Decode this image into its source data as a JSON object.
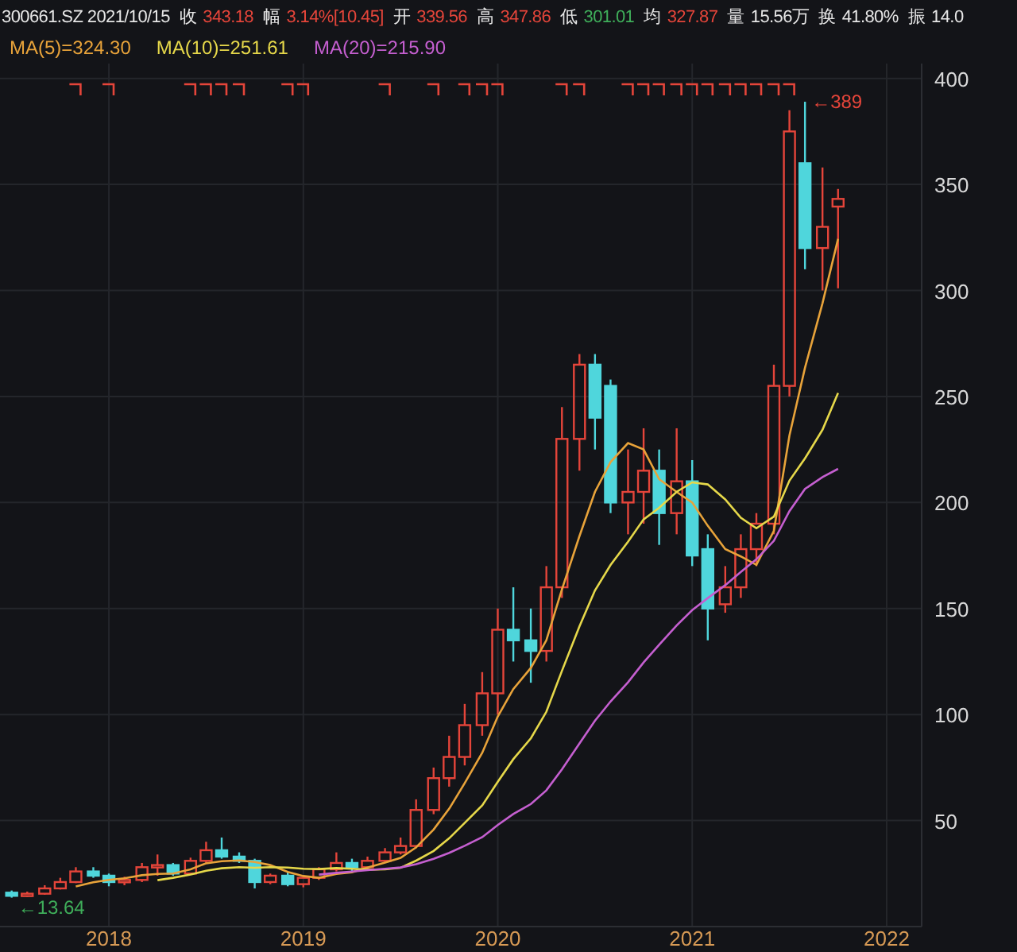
{
  "header": [
    {
      "value": "300661.SZ 2021/10/15",
      "color": "#e6e6e6"
    },
    {
      "label": "收",
      "value": "343.18",
      "color": "#e5453a"
    },
    {
      "label": "幅",
      "value": "3.14%[10.45]",
      "color": "#e5453a"
    },
    {
      "label": "开",
      "value": "339.56",
      "color": "#e5453a"
    },
    {
      "label": "高",
      "value": "347.86",
      "color": "#e5453a"
    },
    {
      "label": "低",
      "value": "301.01",
      "color": "#3fae5a"
    },
    {
      "label": "均",
      "value": "327.87",
      "color": "#e5453a"
    },
    {
      "label": "量",
      "value": "15.56万",
      "color": "#e6e6e6"
    },
    {
      "label": "换",
      "value": "41.80%",
      "color": "#e6e6e6"
    },
    {
      "label": "振",
      "value": "14.0",
      "color": "#e6e6e6"
    }
  ],
  "legend_values": [
    "=324.30",
    "=251.61",
    "=215.90"
  ],
  "chart_data": {
    "type": "candlestick",
    "grid": true,
    "ylim": [
      0,
      407
    ],
    "xlim": [
      2017.44,
      2022.18
    ],
    "xticks": [
      {
        "value": 2018,
        "label": "2018"
      },
      {
        "value": 2019,
        "label": "2019"
      },
      {
        "value": 2020,
        "label": "2020"
      },
      {
        "value": 2021,
        "label": "2021"
      },
      {
        "value": 2022,
        "label": "2022"
      }
    ],
    "yticks": [
      50,
      100,
      150,
      200,
      250,
      300,
      350,
      400
    ],
    "x": [
      2017.5,
      2017.58,
      2017.67,
      2017.75,
      2017.83,
      2017.92,
      2018,
      2018.08,
      2018.17,
      2018.25,
      2018.33,
      2018.42,
      2018.5,
      2018.58,
      2018.67,
      2018.75,
      2018.83,
      2018.92,
      2019,
      2019.08,
      2019.17,
      2019.25,
      2019.33,
      2019.42,
      2019.5,
      2019.58,
      2019.67,
      2019.75,
      2019.83,
      2019.92,
      2020,
      2020.08,
      2020.17,
      2020.25,
      2020.33,
      2020.42,
      2020.5,
      2020.58,
      2020.67,
      2020.75,
      2020.83,
      2020.92,
      2021,
      2021.08,
      2021.17,
      2021.25,
      2021.33,
      2021.42,
      2021.5,
      2021.58,
      2021.67,
      2021.75
    ],
    "ohlc": [
      [
        16,
        17,
        13.64,
        14.5
      ],
      [
        14.5,
        16.5,
        14,
        15.5
      ],
      [
        15.5,
        19.5,
        15,
        18
      ],
      [
        18,
        23,
        17.5,
        21
      ],
      [
        21,
        28,
        20.5,
        26
      ],
      [
        26,
        28,
        23,
        24
      ],
      [
        24,
        25,
        19,
        21
      ],
      [
        21,
        23.5,
        19.5,
        22
      ],
      [
        22,
        30,
        21,
        28
      ],
      [
        28,
        34,
        24,
        29
      ],
      [
        29,
        30,
        24,
        25
      ],
      [
        25,
        32.5,
        24.5,
        31
      ],
      [
        31,
        40,
        30,
        36
      ],
      [
        36,
        42,
        32,
        33
      ],
      [
        33,
        35,
        30,
        31
      ],
      [
        31,
        32,
        18,
        21
      ],
      [
        21,
        25,
        20,
        24
      ],
      [
        24,
        25.5,
        19,
        20
      ],
      [
        20,
        24,
        18.5,
        23
      ],
      [
        23,
        28,
        22,
        27
      ],
      [
        27,
        35,
        26,
        30
      ],
      [
        30,
        32,
        26,
        28
      ],
      [
        28,
        33,
        27,
        31
      ],
      [
        31,
        37,
        30,
        35
      ],
      [
        35,
        42,
        34,
        38
      ],
      [
        38,
        60,
        37,
        55
      ],
      [
        55,
        75,
        53,
        70
      ],
      [
        70,
        90,
        66,
        80
      ],
      [
        80,
        105,
        76,
        95
      ],
      [
        95,
        120,
        90,
        110
      ],
      [
        110,
        150,
        100,
        140
      ],
      [
        140,
        160,
        125,
        135
      ],
      [
        135,
        150,
        115,
        130
      ],
      [
        130,
        170,
        125,
        160
      ],
      [
        160,
        245,
        155,
        230
      ],
      [
        230,
        270,
        215,
        265
      ],
      [
        265,
        270,
        225,
        240
      ],
      [
        255,
        258,
        195,
        200
      ],
      [
        200,
        225,
        185,
        205
      ],
      [
        205,
        235,
        190,
        215
      ],
      [
        215,
        225,
        180,
        195
      ],
      [
        195,
        235,
        185,
        210
      ],
      [
        210,
        220,
        170,
        175
      ],
      [
        178,
        185,
        135,
        150
      ],
      [
        152,
        170,
        148,
        160
      ],
      [
        160,
        185,
        155,
        178
      ],
      [
        178,
        195,
        170,
        190
      ],
      [
        190,
        265,
        185,
        255
      ],
      [
        255,
        385,
        250,
        375
      ],
      [
        360,
        389,
        310,
        320
      ],
      [
        320,
        358,
        300,
        330
      ],
      [
        339.56,
        347.86,
        301.01,
        343.18
      ]
    ],
    "series": [
      {
        "name": "MA(5)",
        "type": "line",
        "color": "#e8a33a",
        "values": [
          null,
          null,
          null,
          null,
          19,
          20.9,
          22,
          22.8,
          24.2,
          24.8,
          25,
          27,
          29.8,
          30.8,
          31.2,
          30.4,
          29,
          25.8,
          23.8,
          23,
          24.8,
          25.6,
          27.8,
          30.2,
          32.4,
          37.4,
          45.8,
          55.6,
          67.6,
          82,
          99,
          112,
          122,
          135,
          159,
          184,
          205,
          219,
          228,
          225,
          211,
          205,
          200,
          189,
          178,
          174.6,
          170.6,
          186.6,
          231.6,
          263.6,
          294,
          324.3
        ]
      },
      {
        "name": "MA(10)",
        "type": "line",
        "color": "#e6d84a",
        "values": [
          null,
          null,
          null,
          null,
          null,
          null,
          null,
          null,
          null,
          21.9,
          23,
          24.5,
          26.3,
          27.5,
          28,
          27.7,
          28,
          27.8,
          27.3,
          27.1,
          27.6,
          27.3,
          26.8,
          27,
          27.7,
          31.1,
          35.7,
          41.7,
          48.9,
          57.2,
          68.2,
          78.9,
          88.8,
          101.3,
          120.5,
          141.5,
          158.5,
          170.5,
          181.5,
          192,
          197.5,
          205,
          209.5,
          208.5,
          201.5,
          192.8,
          187.8,
          193.3,
          210.3,
          220.8,
          234.3,
          251.6
        ]
      },
      {
        "name": "MA(20)",
        "type": "line",
        "color": "#c55fd0",
        "values": [
          null,
          null,
          null,
          null,
          null,
          null,
          null,
          null,
          null,
          null,
          null,
          null,
          null,
          null,
          null,
          null,
          null,
          null,
          null,
          24.5,
          25.3,
          25.9,
          26.6,
          27.3,
          27.9,
          29.4,
          31.9,
          34.8,
          38.1,
          42.2,
          47.9,
          53.1,
          57.8,
          64.2,
          74.1,
          86.3,
          97.1,
          106.1,
          115.2,
          124.6,
          132.9,
          142,
          149.2,
          154.9,
          161,
          167.2,
          173.2,
          181.9,
          195.9,
          206.4,
          212,
          215.9
        ]
      }
    ],
    "annotations": [
      {
        "x": 2021.58,
        "y": 389,
        "text": "←389"
      },
      {
        "x": 2017.5,
        "y": 13.64,
        "text": "←13.64"
      }
    ]
  }
}
